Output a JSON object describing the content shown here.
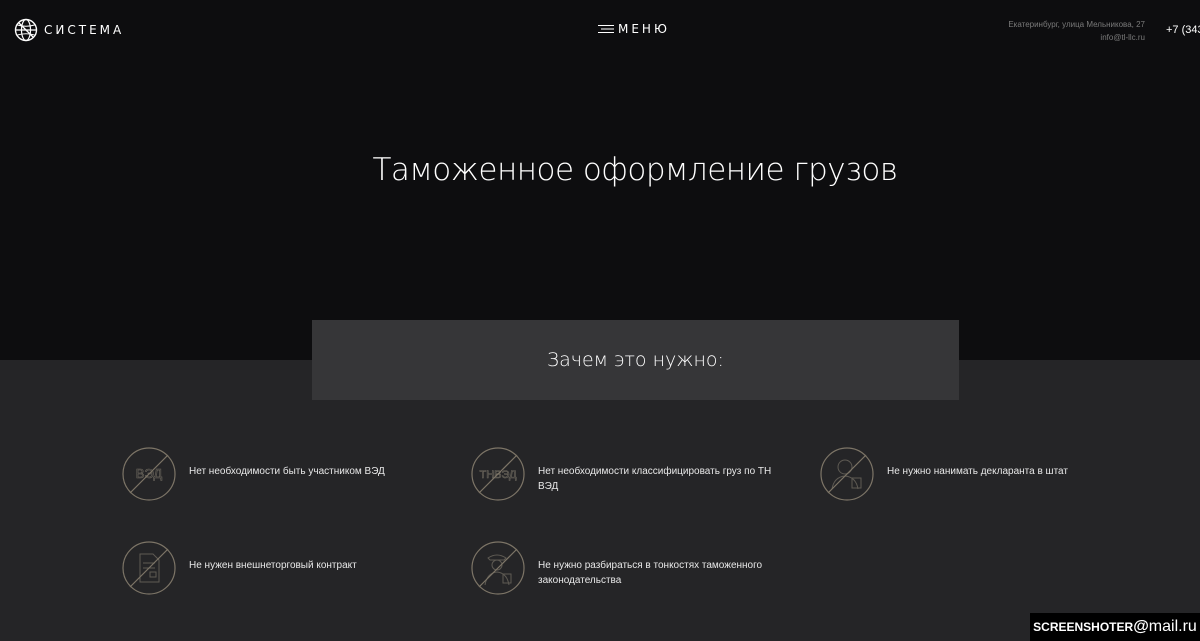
{
  "header": {
    "logo_text": "СИСТЕМА",
    "menu_label": "МЕНЮ",
    "address": "Екатеринбург, улица Мельникова, 27",
    "email": "info@tl-llc.ru",
    "phone": "+7 (343"
  },
  "hero": {
    "title": "Таможенное оформление грузов"
  },
  "why": {
    "title": "Зачем это нужно:"
  },
  "features": [
    {
      "icon": "ved-crossed-icon",
      "icon_text": "ВЭД",
      "text": "Нет необходимости быть участником ВЭД"
    },
    {
      "icon": "tnved-crossed-icon",
      "icon_text": "ТНВЭД",
      "text": "Нет необходимости классифицировать груз по ТН ВЭД"
    },
    {
      "icon": "declarant-crossed-icon",
      "text": "Не нужно нанимать декларанта в штат"
    },
    {
      "icon": "contract-crossed-icon",
      "text": "Не нужен внешнеторговый контракт"
    },
    {
      "icon": "officer-crossed-icon",
      "text": "Не нужно разбираться в тонкостях таможенного законодательства"
    }
  ],
  "watermark": {
    "left": "SCREENSHOTER",
    "at": "@",
    "right": "mail.ru"
  },
  "colors": {
    "hero_bg": "#0d0d0f",
    "section_bg": "#252527",
    "box_bg": "#363638",
    "icon_gold": "#7d7567"
  }
}
